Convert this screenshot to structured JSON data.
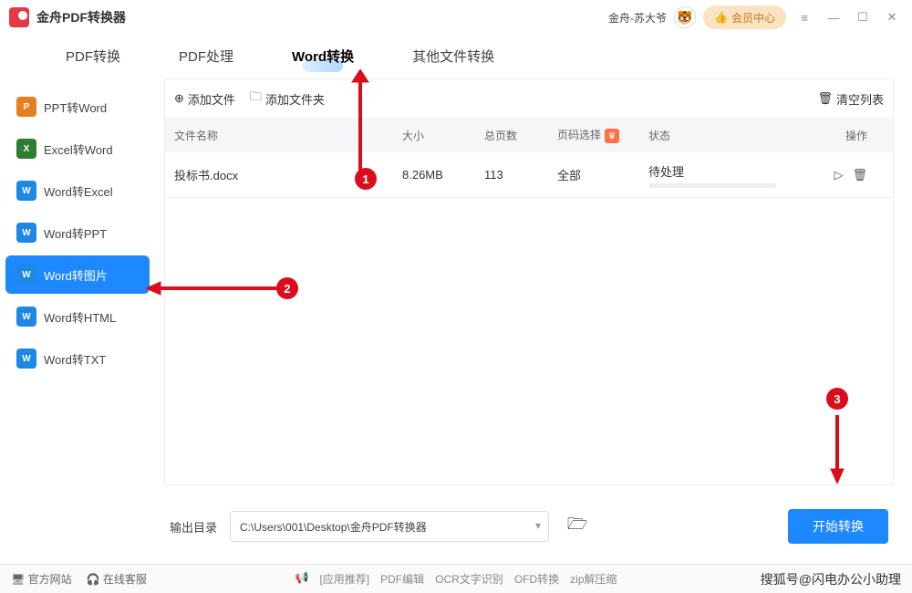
{
  "app": {
    "title": "金舟PDF转换器",
    "username": "金舟-苏大爷",
    "vip_label": "会员中心"
  },
  "tabs": [
    {
      "label": "PDF转换"
    },
    {
      "label": "PDF处理"
    },
    {
      "label": "Word转换",
      "active": true
    },
    {
      "label": "其他文件转换"
    }
  ],
  "sidebar": [
    {
      "label": "PPT转Word",
      "icon": "ppt"
    },
    {
      "label": "Excel转Word",
      "icon": "excel"
    },
    {
      "label": "Word转Excel",
      "icon": "word"
    },
    {
      "label": "Word转PPT",
      "icon": "word"
    },
    {
      "label": "Word转图片",
      "icon": "img",
      "active": true
    },
    {
      "label": "Word转HTML",
      "icon": "html"
    },
    {
      "label": "Word转TXT",
      "icon": "txt"
    }
  ],
  "toolbar": {
    "add_file": "添加文件",
    "add_folder": "添加文件夹",
    "clear": "清空列表"
  },
  "table": {
    "headers": {
      "name": "文件名称",
      "size": "大小",
      "pages": "总页数",
      "range": "页码选择",
      "status": "状态",
      "op": "操作"
    },
    "rows": [
      {
        "name": "投标书.docx",
        "size": "8.26MB",
        "pages": "113",
        "range": "全部",
        "status": "待处理"
      }
    ]
  },
  "output": {
    "label": "输出目录",
    "path": "C:\\Users\\001\\Desktop\\金舟PDF转换器",
    "convert": "开始转换"
  },
  "footer": {
    "left1": "官方网站",
    "left2": "在线客服",
    "links": [
      "[应用推荐]",
      "PDF编辑",
      "OCR文字识别",
      "OFD转换",
      "zip解压缩"
    ],
    "brand": "搜狐号@闪电办公小助理"
  },
  "annot": {
    "n1": "1",
    "n2": "2",
    "n3": "3"
  }
}
